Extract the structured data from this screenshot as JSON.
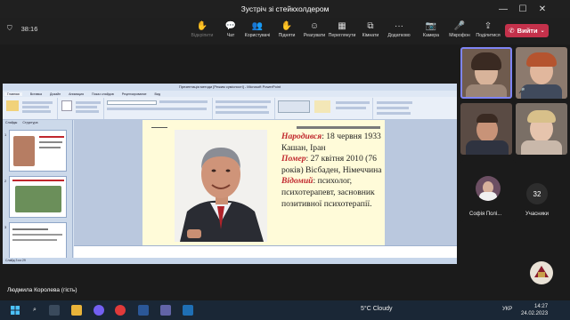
{
  "window": {
    "title": "Зустріч зі стейкхолдером",
    "minimize": "—",
    "maximize": "☐",
    "close": "✕"
  },
  "toolbar": {
    "timer": "38:16",
    "buttons": [
      {
        "icon": "raise-hand-icon",
        "glyph": "✋",
        "label": "Відкріпити",
        "dim": true
      },
      {
        "icon": "chat-icon",
        "glyph": "💬",
        "label": "Чат"
      },
      {
        "icon": "people-icon",
        "glyph": "👥",
        "label": "Користувачі"
      },
      {
        "icon": "hand-icon",
        "glyph": "✋",
        "label": "Підняти"
      },
      {
        "icon": "reactions-icon",
        "glyph": "☺",
        "label": "Реагувати"
      },
      {
        "icon": "view-icon",
        "glyph": "▦",
        "label": "Переглянути"
      },
      {
        "icon": "rooms-icon",
        "glyph": "⧉",
        "label": "Кімнати"
      },
      {
        "icon": "more-icon",
        "glyph": "···",
        "label": "Додатково"
      },
      {
        "icon": "camera-icon",
        "glyph": "📷",
        "label": "Камера"
      },
      {
        "icon": "mic-off-icon",
        "glyph": "🎤",
        "label": "Мікрофон"
      },
      {
        "icon": "share-icon",
        "glyph": "⇪",
        "label": "Поділитися"
      }
    ],
    "leave_label": "Вийти"
  },
  "presentation": {
    "app_title": "Презентація методи [Режим сумісності] - Microsoft PowerPoint",
    "ribbon_tabs": [
      "Главная",
      "Вставка",
      "Дизайн",
      "Анимация",
      "Показ слайдов",
      "Рецензирование",
      "Вид"
    ],
    "panel_tabs": [
      "Слайды",
      "Структура"
    ],
    "slide_numbers": [
      "1",
      "2",
      "3"
    ],
    "status": "Слайд 3 из 29",
    "slide": {
      "born_label": "Народився",
      "born_text": ": 18 червня 1933 Кашан, Іран",
      "died_label": "Помер",
      "died_text": ": 27 квітня 2010 (76 років) Вісбаден, Німеччина",
      "known_label": "Відомий",
      "known_text": ": психолог, психотерапевт, засновник позитивної психотерапії."
    }
  },
  "participants": [
    {
      "name": ""
    },
    {
      "name": ""
    },
    {
      "name": ""
    },
    {
      "name": ""
    },
    {
      "name": "Софія Полі..."
    }
  ],
  "others": {
    "count": "32",
    "label": "Учасники"
  },
  "presenter": "Людмила Королева (гість)",
  "taskbar": {
    "weather": "5°C  Cloudy",
    "language": "УКР",
    "time": "14:27",
    "date": "24.02.2023"
  },
  "colors": {
    "leave": "#c4314b",
    "slide_key": "#c0272d",
    "slide_bg": "#fffbd9"
  }
}
